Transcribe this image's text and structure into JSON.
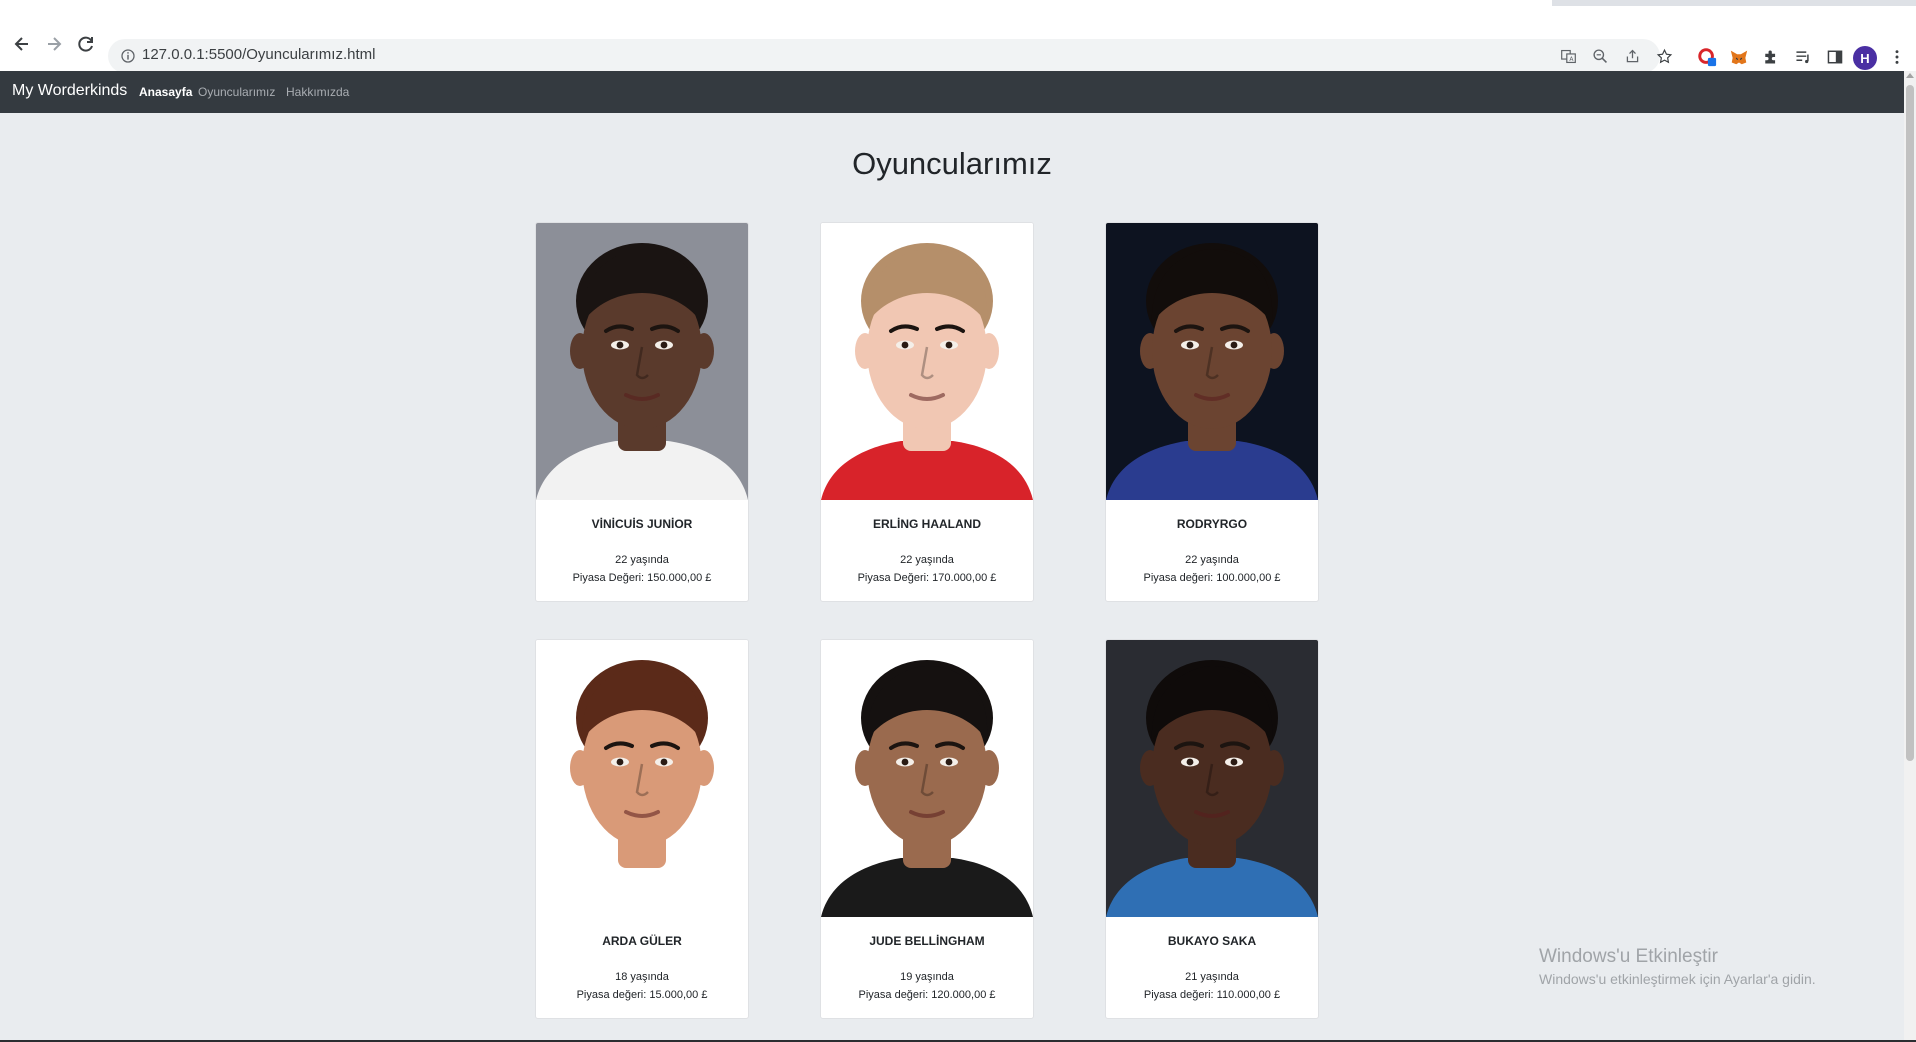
{
  "browser": {
    "url": "127.0.0.1:5500/Oyuncularımız.html",
    "avatar_letter": "H"
  },
  "navbar": {
    "brand": "My Worderkinds",
    "links": [
      {
        "label": "Anasayfa",
        "active": true
      },
      {
        "label": "Oyuncularımız",
        "active": false
      },
      {
        "label": "Hakkımızda",
        "active": false
      }
    ]
  },
  "page": {
    "title": "Oyuncularımız"
  },
  "players": [
    {
      "name": "VİNİCUİS JUNİOR",
      "age": "22 yaşında",
      "value": "Piyasa Değeri: 150.000,00 £",
      "skin": "#5a3a2c",
      "hair": "#1a1412",
      "bg": "#8c8f98",
      "shirt": "#f2f2f2"
    },
    {
      "name": "ERLİNG HAALAND",
      "age": "22 yaşında",
      "value": "Piyasa Değeri: 170.000,00 £",
      "skin": "#f1c7b3",
      "hair": "#b58f6a",
      "bg": "#ffffff",
      "shirt": "#d8232a"
    },
    {
      "name": "RODRYRGO",
      "age": "22 yaşında",
      "value": "Piyasa değeri: 100.000,00 £",
      "skin": "#6b4431",
      "hair": "#120d0b",
      "bg": "#0d1320",
      "shirt": "#2a3c8f"
    },
    {
      "name": "ARDA GÜLER",
      "age": "18 yaşında",
      "value": "Piyasa değeri: 15.000,00 £",
      "skin": "#d99a78",
      "hair": "#5b2a19",
      "bg": "#ffffff",
      "shirt": "#ffffff"
    },
    {
      "name": "JUDE BELLİNGHAM",
      "age": "19 yaşında",
      "value": "Piyasa değeri: 120.000,00 £",
      "skin": "#9a6a4e",
      "hair": "#151110",
      "bg": "#ffffff",
      "shirt": "#1a1a1a"
    },
    {
      "name": "BUKAYO SAKA",
      "age": "21 yaşında",
      "value": "Piyasa değeri: 110.000,00 £",
      "skin": "#4a2c20",
      "hair": "#0f0b0a",
      "bg": "#2a2c32",
      "shirt": "#2f6fb4"
    }
  ],
  "watermark": {
    "title": "Windows'u Etkinleştir",
    "subtitle": "Windows'u etkinleştirmek için Ayarlar'a gidin."
  }
}
